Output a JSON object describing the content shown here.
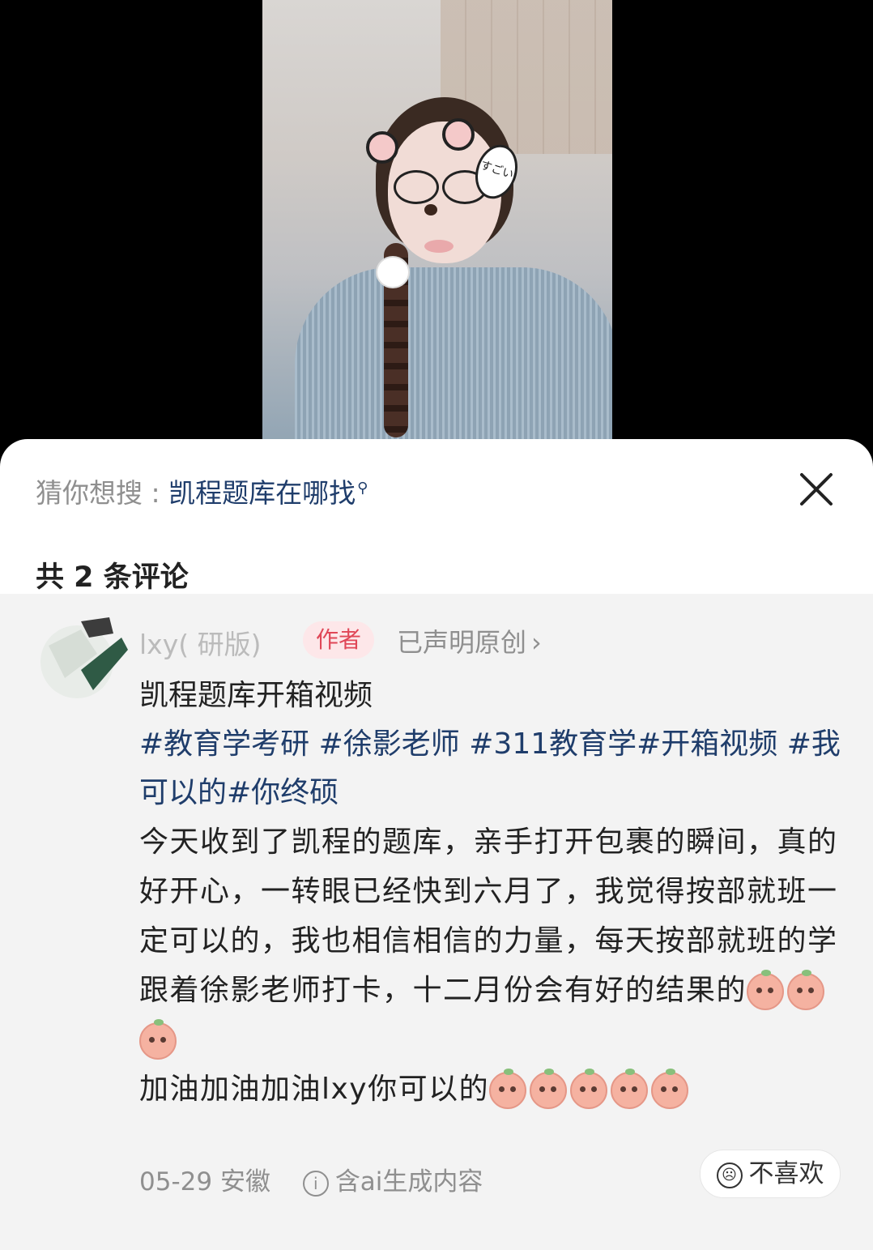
{
  "video": {
    "bubble_text": "すごい"
  },
  "search_suggestion": {
    "prefix": "猜你想搜 : ",
    "keyword": "凯程题库在哪找"
  },
  "comments_header": {
    "count_label": "共 2 条评论"
  },
  "comment": {
    "username": "lxy(  研版)",
    "author_badge": "作者",
    "original_label": "已声明原创",
    "title": "凯程题库开箱视频",
    "hashtags": [
      "#教育学考研",
      "#徐影老师",
      "#311教育学",
      "#开箱视频",
      "#我可以的",
      "#你终硕"
    ],
    "body_line_1": "今天收到了凯程的题库，亲手打开包裹的瞬间，真的好开心，一转眼已经快到六月了，我觉得按部就班一定可以的，我也相信相信的力量，每天按部就班的学跟着徐影老师打卡，十二月份会有好的结果的",
    "body_line_2": "加油加油加油lxy你可以的",
    "date": "05-29",
    "location": "安徽",
    "ai_label": "含ai生成内容",
    "dislike_label": "不喜欢"
  }
}
